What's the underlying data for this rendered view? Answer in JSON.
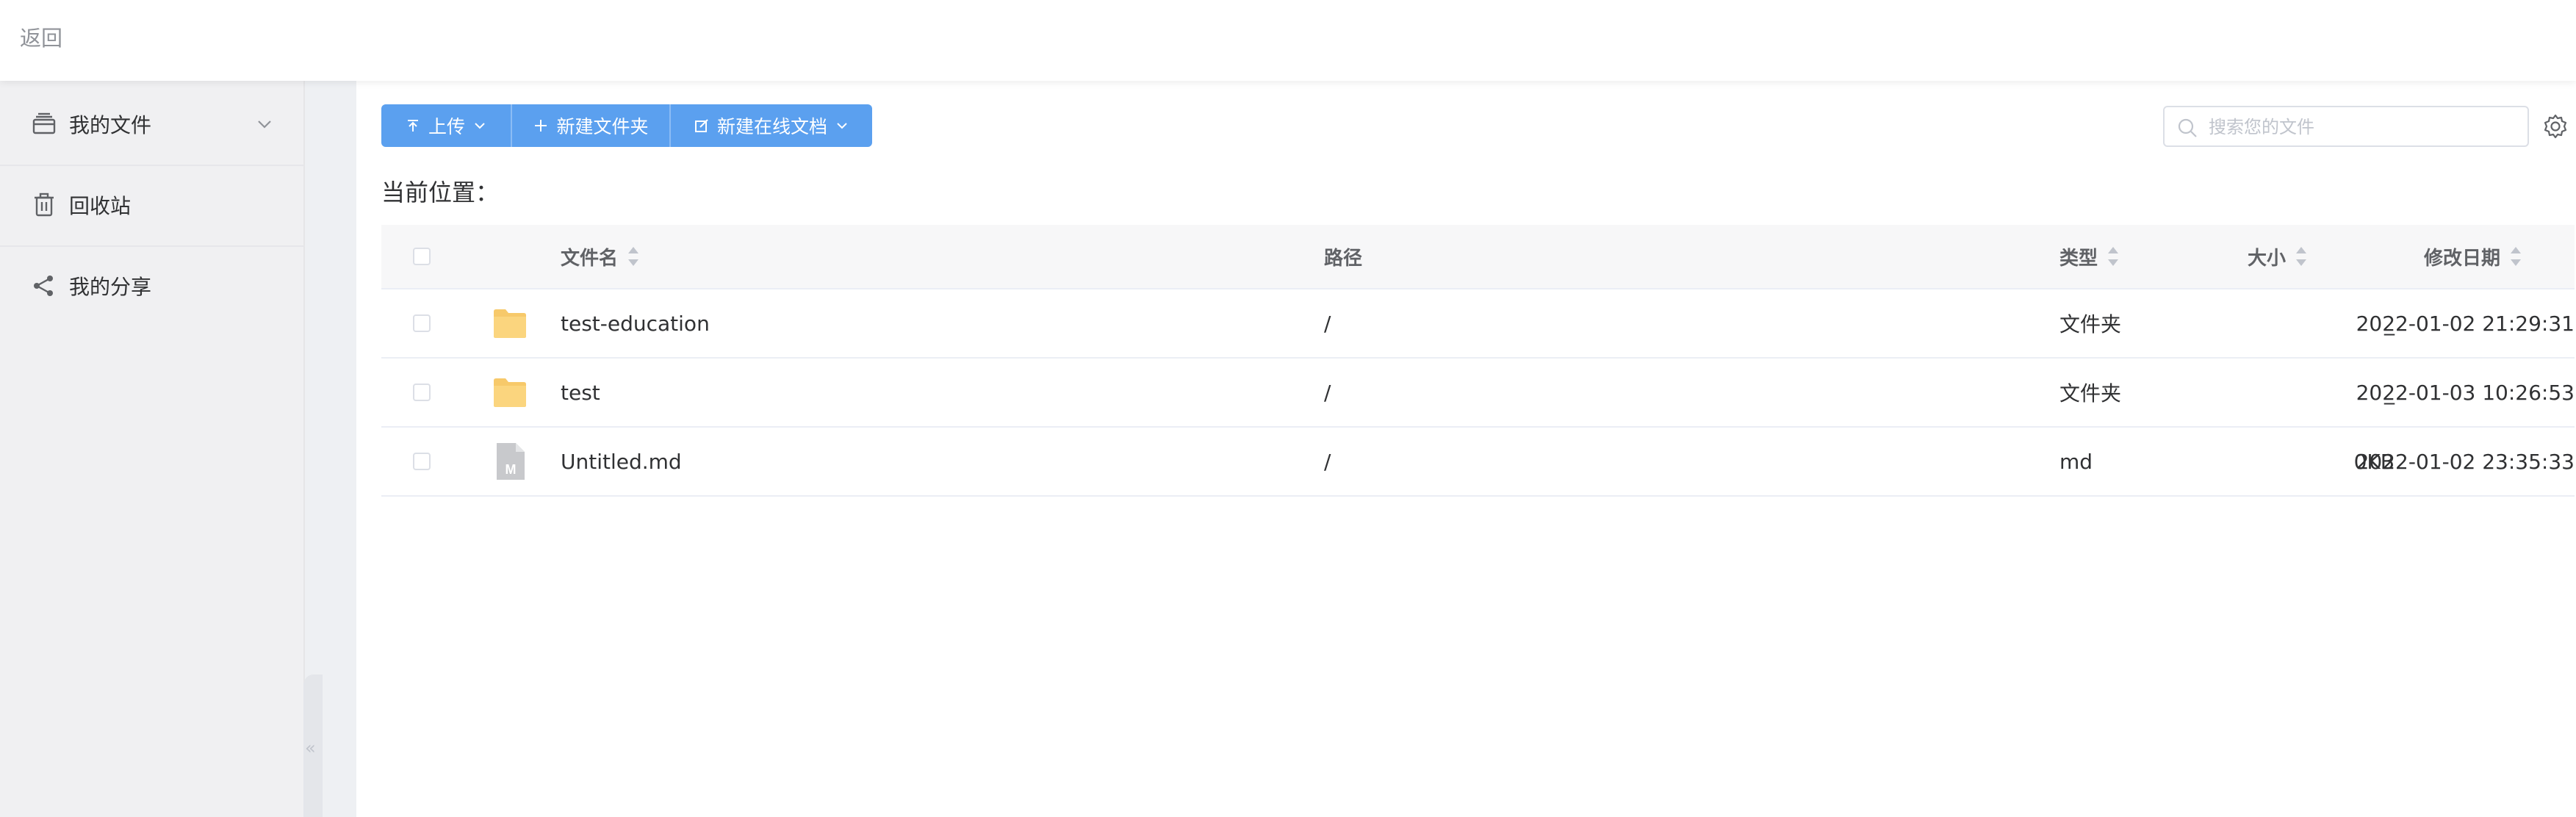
{
  "header": {
    "back_label": "返回"
  },
  "sidebar": {
    "items": [
      {
        "label": "我的文件",
        "icon": "folder-stack-icon",
        "has_submenu": true
      },
      {
        "label": "回收站",
        "icon": "trash-icon"
      },
      {
        "label": "我的分享",
        "icon": "share-icon"
      }
    ],
    "collapse_glyph": "«"
  },
  "toolbar": {
    "upload_label": "上传",
    "new_folder_label": "新建文件夹",
    "new_doc_label": "新建在线文档",
    "accent_color": "#5ba0ef"
  },
  "search": {
    "placeholder": "搜索您的文件",
    "value": ""
  },
  "breadcrumb": {
    "label": "当前位置："
  },
  "table": {
    "columns": {
      "name": "文件名",
      "path": "路径",
      "type": "类型",
      "size": "大小",
      "date": "修改日期"
    },
    "rows": [
      {
        "icon": "folder-icon",
        "name": "test-education",
        "path": "/",
        "type": "文件夹",
        "size": "_",
        "date": "2022-01-02 21:29:31"
      },
      {
        "icon": "folder-icon",
        "name": "test",
        "path": "/",
        "type": "文件夹",
        "size": "_",
        "date": "2022-01-03 10:26:53"
      },
      {
        "icon": "markdown-file-icon",
        "name": "Untitled.md",
        "path": "/",
        "type": "md",
        "size": "0KB",
        "date": "2022-01-02 23:35:33"
      }
    ]
  }
}
